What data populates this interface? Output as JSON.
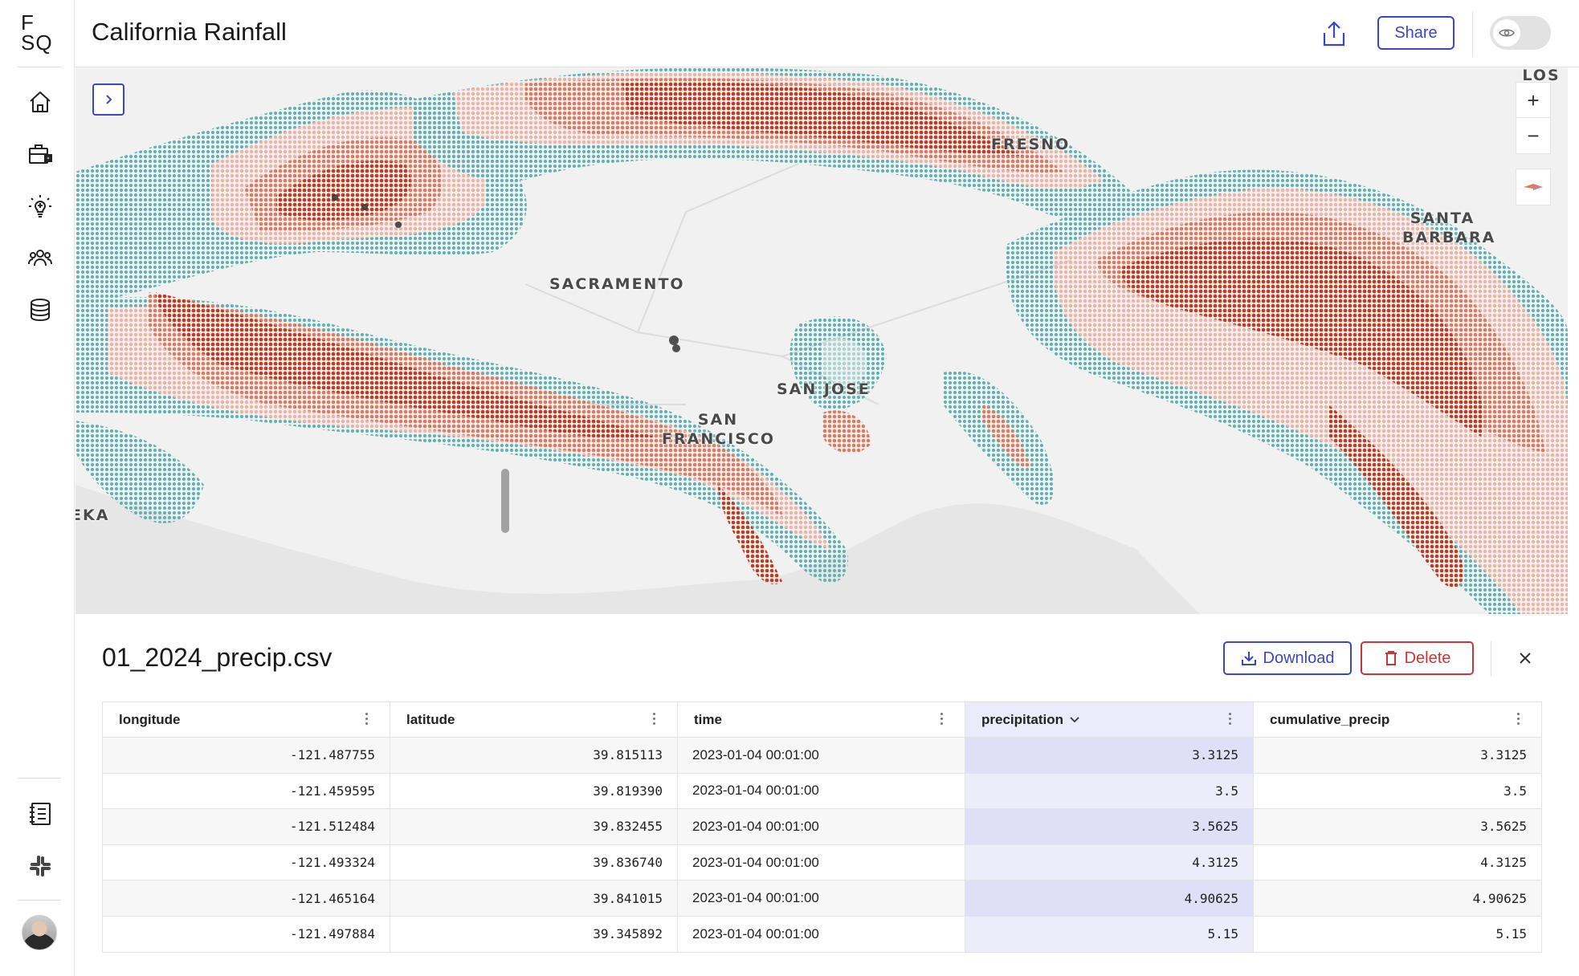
{
  "app": {
    "logo_line1": "F",
    "logo_line2": "SQ",
    "title": "California Rainfall",
    "share_label": "Share"
  },
  "sidebar": {
    "top_items": [
      {
        "icon": "home-icon"
      },
      {
        "icon": "briefcase-icon"
      },
      {
        "icon": "lightbulb-icon"
      },
      {
        "icon": "team-icon"
      },
      {
        "icon": "database-icon"
      }
    ],
    "bottom_items": [
      {
        "icon": "notebook-icon"
      },
      {
        "icon": "slack-icon"
      }
    ]
  },
  "map": {
    "labels": {
      "los_angeles": "LOS A",
      "fresno": "FRESNO",
      "santa_barbara_1": "SANTA",
      "santa_barbara_2": "BARBARA",
      "sacramento": "SACRAMENTO",
      "san_jose": "SAN JOSE",
      "san_francisco_1": "SAN",
      "san_francisco_2": "FRANCISCO",
      "eureka": "EKA"
    },
    "zoom_in": "+",
    "zoom_out": "−",
    "colors": {
      "low": "#5fb3b3",
      "mid_low": "#a8d6d4",
      "mid": "#f2b3a4",
      "high": "#e07a5f",
      "highest": "#c23b1f"
    }
  },
  "dataset": {
    "file_name": "01_2024_precip.csv",
    "download_label": "Download",
    "delete_label": "Delete",
    "columns": [
      "longitude",
      "latitude",
      "time",
      "precipitation",
      "cumulative_precip"
    ],
    "sorted_column": "precipitation",
    "rows": [
      [
        "-121.487755",
        "39.815113",
        "2023-01-04 00:01:00",
        "3.3125",
        "3.3125"
      ],
      [
        "-121.459595",
        "39.819390",
        "2023-01-04 00:01:00",
        "3.5",
        "3.5"
      ],
      [
        "-121.512484",
        "39.832455",
        "2023-01-04 00:01:00",
        "3.5625",
        "3.5625"
      ],
      [
        "-121.493324",
        "39.836740",
        "2023-01-04 00:01:00",
        "4.3125",
        "4.3125"
      ],
      [
        "-121.465164",
        "39.841015",
        "2023-01-04 00:01:00",
        "4.90625",
        "4.90625"
      ],
      [
        "-121.497884",
        "39.345892",
        "2023-01-04 00:01:00",
        "5.15",
        "5.15"
      ]
    ]
  }
}
